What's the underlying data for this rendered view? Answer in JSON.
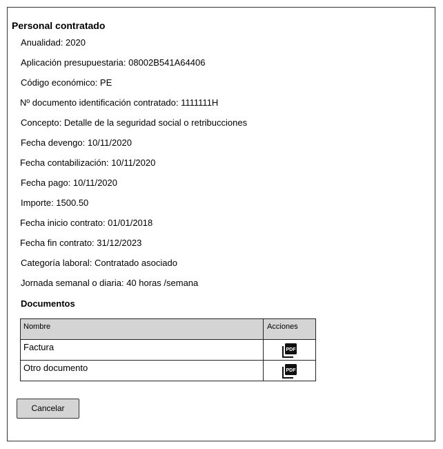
{
  "title": "Personal contratado",
  "fields": [
    {
      "label": "Anualidad: 2020"
    },
    {
      "label": "Aplicación presupuestaria: 08002B541A64406"
    },
    {
      "label": "Código económico: PE"
    },
    {
      "label": "Nº documento identificación contratado: 1111111H"
    },
    {
      "label": "Concepto: Detalle de la seguridad social o retribucciones"
    },
    {
      "label": "Fecha devengo: 10/11/2020"
    },
    {
      "label": "Fecha contabilización: 10/11/2020"
    },
    {
      "label": "Fecha pago: 10/11/2020"
    },
    {
      "label": "Importe: 1500.50"
    },
    {
      "label": "Fecha inicio contrato: 01/01/2018"
    },
    {
      "label": "Fecha fin contrato: 31/12/2023"
    },
    {
      "label": "Categoría laboral: Contratado asociado"
    },
    {
      "label": "Jornada semanal o diaria: 40 horas /semana"
    }
  ],
  "documents": {
    "title": "Documentos",
    "columns": {
      "name": "Nombre",
      "actions": "Acciones"
    },
    "rows": [
      {
        "name": "Factura",
        "action_icon": "pdf-icon"
      },
      {
        "name": "Otro documento",
        "action_icon": "pdf-icon"
      }
    ]
  },
  "buttons": {
    "cancel": "Cancelar"
  },
  "colors": {
    "header_bg": "#d4d4d4",
    "button_bg": "#d4d4d4",
    "border": "#222222"
  }
}
